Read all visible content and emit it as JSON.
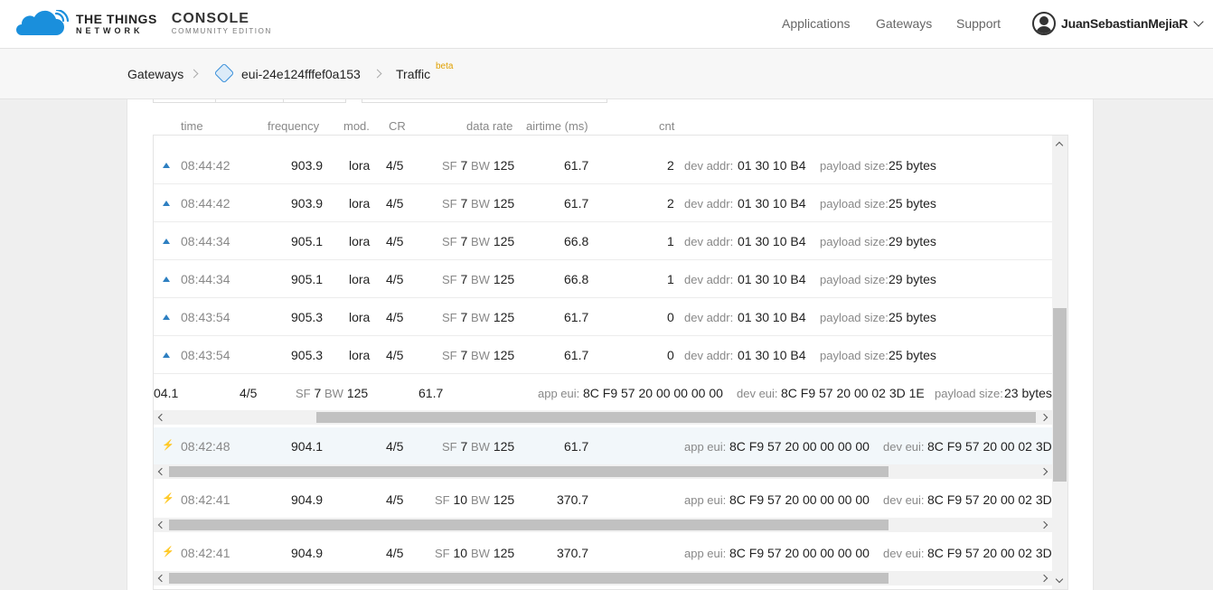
{
  "header": {
    "brand_line1": "THE THINGS",
    "brand_line2": "NETWORK",
    "console_line1": "CONSOLE",
    "console_line2": "COMMUNITY EDITION",
    "nav": [
      "Applications",
      "Gateways",
      "Support"
    ],
    "user_name": "JuanSebastianMejiaR"
  },
  "breadcrumb": {
    "items": [
      "Gateways",
      "eui-24e124fffef0a153",
      "Traffic"
    ],
    "badge": "beta"
  },
  "table": {
    "columns": [
      "time",
      "frequency",
      "mod.",
      "CR",
      "data rate",
      "airtime (ms)",
      "cnt"
    ],
    "uplink_rows": [
      {
        "time": "08:44:42",
        "frequency": "903.9",
        "mod": "lora",
        "cr": "4/5",
        "sf_label": "SF",
        "sf": "7",
        "bw_label": "BW",
        "bw": "125",
        "airtime": "61.7",
        "cnt": "2",
        "addr_label": "dev addr:",
        "addr": "01 30 10 B4",
        "payload_label": "payload size:",
        "payload": "25 bytes"
      },
      {
        "time": "08:44:42",
        "frequency": "903.9",
        "mod": "lora",
        "cr": "4/5",
        "sf_label": "SF",
        "sf": "7",
        "bw_label": "BW",
        "bw": "125",
        "airtime": "61.7",
        "cnt": "2",
        "addr_label": "dev addr:",
        "addr": "01 30 10 B4",
        "payload_label": "payload size:",
        "payload": "25 bytes"
      },
      {
        "time": "08:44:34",
        "frequency": "905.1",
        "mod": "lora",
        "cr": "4/5",
        "sf_label": "SF",
        "sf": "7",
        "bw_label": "BW",
        "bw": "125",
        "airtime": "66.8",
        "cnt": "1",
        "addr_label": "dev addr:",
        "addr": "01 30 10 B4",
        "payload_label": "payload size:",
        "payload": "29 bytes"
      },
      {
        "time": "08:44:34",
        "frequency": "905.1",
        "mod": "lora",
        "cr": "4/5",
        "sf_label": "SF",
        "sf": "7",
        "bw_label": "BW",
        "bw": "125",
        "airtime": "66.8",
        "cnt": "1",
        "addr_label": "dev addr:",
        "addr": "01 30 10 B4",
        "payload_label": "payload size:",
        "payload": "29 bytes"
      },
      {
        "time": "08:43:54",
        "frequency": "905.3",
        "mod": "lora",
        "cr": "4/5",
        "sf_label": "SF",
        "sf": "7",
        "bw_label": "BW",
        "bw": "125",
        "airtime": "61.7",
        "cnt": "0",
        "addr_label": "dev addr:",
        "addr": "01 30 10 B4",
        "payload_label": "payload size:",
        "payload": "25 bytes"
      },
      {
        "time": "08:43:54",
        "frequency": "905.3",
        "mod": "lora",
        "cr": "4/5",
        "sf_label": "SF",
        "sf": "7",
        "bw_label": "BW",
        "bw": "125",
        "airtime": "61.7",
        "cnt": "0",
        "addr_label": "dev addr:",
        "addr": "01 30 10 B4",
        "payload_label": "payload size:",
        "payload": "25 bytes"
      }
    ],
    "scrolled_row": {
      "frequency": "04.1",
      "cr": "4/5",
      "sf_label": "SF",
      "sf": "7",
      "bw_label": "BW",
      "bw": "125",
      "airtime": "61.7",
      "app_label": "app eui:",
      "app_eui": "8C F9 57 20 00 00 00 00",
      "dev_label": "dev eui:",
      "dev_eui": "8C F9 57 20 00 02 3D 1E",
      "payload_label": "payload size:",
      "payload": "23 bytes"
    },
    "join_rows": [
      {
        "time": "08:42:48",
        "frequency": "904.1",
        "cr": "4/5",
        "sf_label": "SF",
        "sf": "7",
        "bw_label": "BW",
        "bw": "125",
        "airtime": "61.7",
        "app_label": "app eui:",
        "app_eui": "8C F9 57 20 00 00 00 00",
        "dev_label": "dev eui:",
        "dev_eui": "8C F9 57 20 00 02 3D"
      },
      {
        "time": "08:42:41",
        "frequency": "904.9",
        "cr": "4/5",
        "sf_label": "SF",
        "sf": "10",
        "bw_label": "BW",
        "bw": "125",
        "airtime": "370.7",
        "app_label": "app eui:",
        "app_eui": "8C F9 57 20 00 00 00 00",
        "dev_label": "dev eui:",
        "dev_eui": "8C F9 57 20 00 02 3D"
      },
      {
        "time": "08:42:41",
        "frequency": "904.9",
        "cr": "4/5",
        "sf_label": "SF",
        "sf": "10",
        "bw_label": "BW",
        "bw": "125",
        "airtime": "370.7",
        "app_label": "app eui:",
        "app_eui": "8C F9 57 20 00 00 00 00",
        "dev_label": "dev eui:",
        "dev_eui": "8C F9 57 20 00 02 3D"
      }
    ]
  },
  "icons": {
    "uplink": "uplink-arrow-icon",
    "join": "lightning-bolt-icon",
    "brand": "cloud-logo-icon",
    "gateway": "gateway-icon"
  },
  "colors": {
    "brand_blue": "#1a8fdc",
    "uplink_blue": "#2d7fc1",
    "join_yellow": "#f0b400",
    "beta_orange": "#e0a000"
  }
}
